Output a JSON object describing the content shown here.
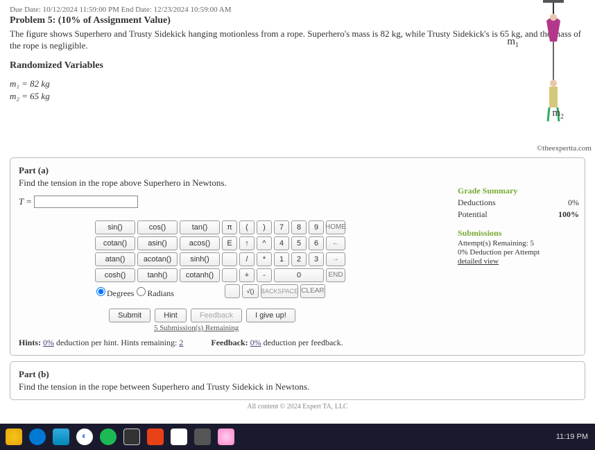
{
  "header": {
    "dates": "Due Date: 10/12/2024 11:59:00 PM End Date: 12/23/2024 10:59:00 AM",
    "problem_title": "Problem 5: (10% of Assignment Value)",
    "description": "The figure shows Superhero and Trusty Sidekick hanging motionless from a rope. Superhero's mass is 82 kg, while Trusty Sidekick's is 65 kg, and the mass of the rope is negligible.",
    "randomized": "Randomized Variables",
    "m1": "m₁ = 82 kg",
    "m2": "m₂ = 65 kg"
  },
  "figure": {
    "m1_label": "m",
    "m1_sub": "1",
    "m2_label": "m",
    "m2_sub": "2",
    "copyright": "©theexpertta.com"
  },
  "part_a": {
    "label": "Part (a)",
    "question": "Find the tension in the rope above Superhero in Newtons.",
    "var": "T =",
    "input_value": ""
  },
  "keypad": {
    "r1": [
      "sin()",
      "cos()",
      "tan()"
    ],
    "r2": [
      "cotan()",
      "asin()",
      "acos()"
    ],
    "r3": [
      "atan()",
      "acotan()",
      "sinh()"
    ],
    "r4": [
      "cosh()",
      "tanh()",
      "cotanh()"
    ],
    "consts_r1": [
      "π",
      "(",
      ")"
    ],
    "consts_r2": [
      "E",
      "↑",
      "^"
    ],
    "consts_r3": [
      "",
      "/",
      "*"
    ],
    "consts_r4": [
      "",
      "+",
      "-"
    ],
    "consts_r5": [
      "",
      "√()"
    ],
    "nums_r1": [
      "7",
      "8",
      "9"
    ],
    "nums_r2": [
      "4",
      "5",
      "6"
    ],
    "nums_r3": [
      "1",
      "2",
      "3"
    ],
    "nums_r4": [
      "0"
    ],
    "ops": [
      "HOME",
      "←",
      "→",
      "END",
      "CLEAR"
    ],
    "back": "BACKSPACE",
    "mode_deg": "Degrees",
    "mode_rad": "Radians"
  },
  "actions": {
    "submit": "Submit",
    "hint": "Hint",
    "feedback": "Feedback",
    "giveup": "I give up!",
    "remain": "5 Submission(s) Remaining"
  },
  "hints": {
    "left_prefix": "Hints: ",
    "left_pct": "0%",
    "left_mid": " deduction per hint. Hints remaining: ",
    "left_count": "2",
    "right_prefix": "Feedback: ",
    "right_pct": "0%",
    "right_suffix": " deduction per feedback."
  },
  "grade": {
    "title": "Grade Summary",
    "ded_label": "Deductions",
    "ded_val": "0%",
    "pot_label": "Potential",
    "pot_val": "100%",
    "sub_title": "Submissions",
    "attempts": "Attempt(s) Remaining: 5",
    "ded_attempt": "0% Deduction per Attempt",
    "detail": "detailed view"
  },
  "part_b": {
    "label": "Part (b)",
    "question": "Find the tension in the rope between Superhero and Trusty Sidekick in Newtons."
  },
  "footer": "All content © 2024 Expert TA, LLC",
  "taskbar": {
    "time": "11:19 PM"
  }
}
